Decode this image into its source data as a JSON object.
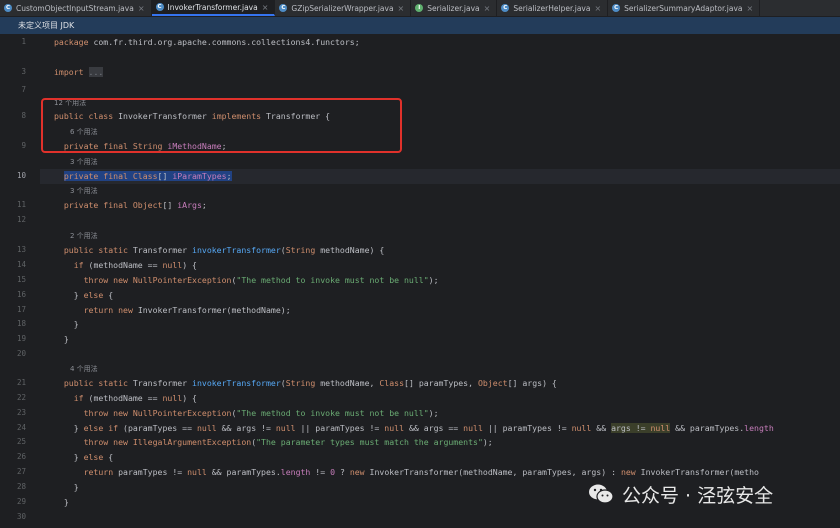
{
  "tabs": [
    {
      "label": "CustomObjectInputStream.java",
      "kind": "class",
      "active": false
    },
    {
      "label": "InvokerTransformer.java",
      "kind": "class",
      "active": true
    },
    {
      "label": "GZipSerializerWrapper.java",
      "kind": "class",
      "active": false
    },
    {
      "label": "Serializer.java",
      "kind": "interface",
      "active": false
    },
    {
      "label": "SerializerHelper.java",
      "kind": "class",
      "active": false
    },
    {
      "label": "SerializerSummaryAdaptor.java",
      "kind": "class",
      "active": false
    }
  ],
  "tab_icon_letter": {
    "class": "C",
    "interface": "I"
  },
  "notice": "未定义项目 JDK",
  "code": {
    "pkg_kw": "package",
    "pkg_name": "com.fr.third.org.apache.commons.collections4.functors;",
    "import_kw": "import",
    "import_dots": "...",
    "usage_12": "12 个用法",
    "usage_6": "6 个用法",
    "usage_3a": "3 个用法",
    "usage_3b": "3 个用法",
    "usage_2": "2 个用法",
    "usage_4": "4 个用法"
  },
  "line_numbers": [
    "1",
    "3",
    "7",
    "8",
    "9",
    "10",
    "11",
    "12",
    "13",
    "14",
    "15",
    "16",
    "17",
    "18",
    "19",
    "20",
    "21",
    "22",
    "23",
    "24",
    "25",
    "26",
    "27",
    "28",
    "29",
    "30"
  ],
  "watermark": "公众号 · 泾弦安全"
}
